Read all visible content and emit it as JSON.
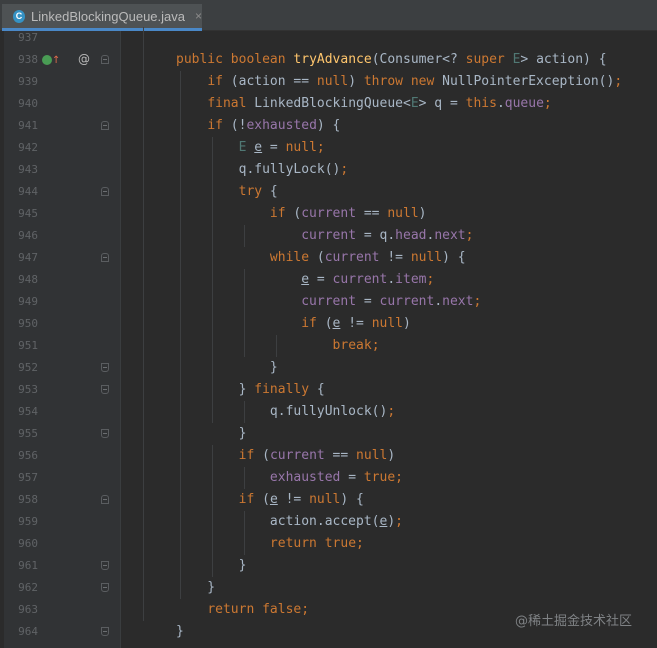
{
  "tab": {
    "file_name": "LinkedBlockingQueue.java",
    "icon_letter": "C",
    "close_glyph": "×"
  },
  "gutter": {
    "line_numbers": [
      "937",
      "938",
      "939",
      "940",
      "941",
      "942",
      "943",
      "944",
      "945",
      "946",
      "947",
      "948",
      "949",
      "950",
      "951",
      "952",
      "953",
      "954",
      "955",
      "956",
      "957",
      "958",
      "959",
      "960",
      "961",
      "962",
      "963",
      "964"
    ],
    "override_marker": "↑",
    "annotation_marker": "@"
  },
  "code_lines": [
    "",
    "public boolean tryAdvance(Consumer<? super E> action) {",
    "    if (action == null) throw new NullPointerException();",
    "    final LinkedBlockingQueue<E> q = this.queue;",
    "    if (!exhausted) {",
    "        E e = null;",
    "        q.fullyLock();",
    "        try {",
    "            if (current == null)",
    "                current = q.head.next;",
    "            while (current != null) {",
    "                e = current.item;",
    "                current = current.next;",
    "                if (e != null)",
    "                    break;",
    "            }",
    "        } finally {",
    "            q.fullyUnlock();",
    "        }",
    "        if (current == null)",
    "            exhausted = true;",
    "        if (e != null) {",
    "            action.accept(e);",
    "            return true;",
    "        }",
    "    }",
    "    return false;",
    "}"
  ],
  "watermark": "@稀土掘金技术社区",
  "colors": {
    "background": "#2b2b2b",
    "keyword": "#cc7832",
    "method_name": "#ffc66d",
    "field": "#9876aa",
    "type_param": "#507874",
    "default_text": "#a9b7c6",
    "line_number": "#606366"
  }
}
